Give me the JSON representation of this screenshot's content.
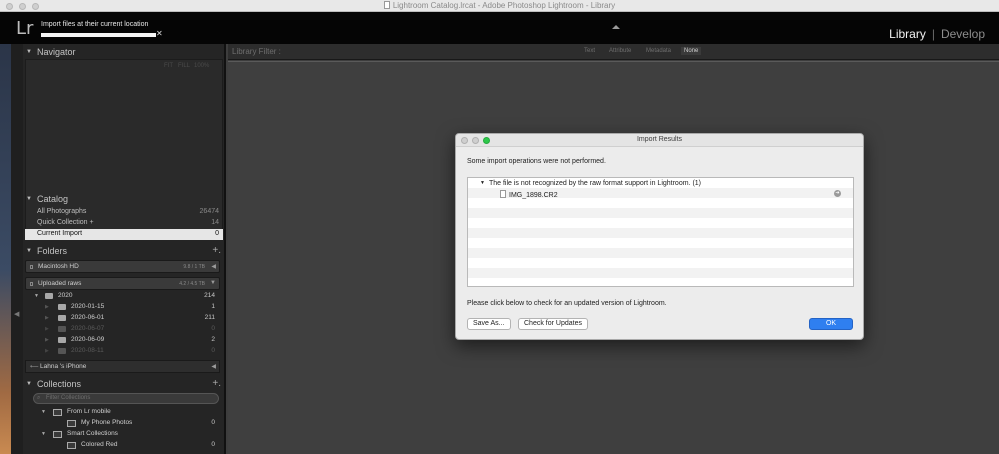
{
  "window": {
    "title": "Lightroom Catalog.lrcat - Adobe Photoshop Lightroom - Library"
  },
  "identity_plate": {
    "logo": "Lr",
    "status_text": "Import files at their current location",
    "progress_percent": 100,
    "close_glyph": "✕"
  },
  "module_picker": {
    "items": [
      "Library",
      "Develop"
    ],
    "active": "Library",
    "separator": "|"
  },
  "left_panel": {
    "navigator": {
      "title": "Navigator"
    },
    "catalog": {
      "title": "Catalog",
      "items": [
        {
          "label": "All Photographs",
          "count": "26474"
        },
        {
          "label": "Quick Collection +",
          "count": "14"
        },
        {
          "label": "Current Import",
          "count": "0"
        }
      ]
    },
    "folders": {
      "title": "Folders",
      "add": "+.",
      "volumes": [
        {
          "label": "Macintosh HD",
          "info": "9.8 / 1 TB"
        },
        {
          "label": "Uploaded raws",
          "info": "4.2 / 4.5 TB"
        }
      ],
      "tree": [
        {
          "label": "2020",
          "count": "214",
          "level": 0
        },
        {
          "label": "2020-01-15",
          "count": "1",
          "level": 1
        },
        {
          "label": "2020-06-01",
          "count": "211",
          "level": 1
        },
        {
          "label": "2020-06-07",
          "count": "0",
          "level": 1
        },
        {
          "label": "2020-06-09",
          "count": "2",
          "level": 1
        },
        {
          "label": "2020-08-11",
          "count": "0",
          "level": 1
        }
      ],
      "device": "Lahna 's iPhone"
    },
    "collections": {
      "title": "Collections",
      "add": "+.",
      "filter_placeholder": "Filter Collections",
      "items": [
        {
          "label": "From Lr mobile",
          "count": ""
        },
        {
          "label": "My Phone Photos",
          "count": "0"
        },
        {
          "label": "Smart Collections",
          "count": ""
        },
        {
          "label": "Colored Red",
          "count": "0"
        }
      ]
    }
  },
  "library_filter": {
    "title": "Library Filter :",
    "options": [
      "Text",
      "Attribute",
      "Metadata",
      "None"
    ],
    "active": "None"
  },
  "dialog": {
    "title": "Import Results",
    "message": "Some import operations were not performed.",
    "group": "The file is not recognized by the raw format support in Lightroom. (1)",
    "file": "IMG_1898.CR2",
    "note": "Please click below to check for an updated version of Lightroom.",
    "buttons": {
      "save_as": "Save As...",
      "check_updates": "Check for Updates",
      "ok": "OK"
    },
    "traffic_colors": [
      "#cfcfcf",
      "#cfcfcf",
      "#2dc84a"
    ]
  },
  "colors": {
    "accent": "#2f7ff0",
    "panel": "#252525",
    "background": "#3f3f3f"
  }
}
